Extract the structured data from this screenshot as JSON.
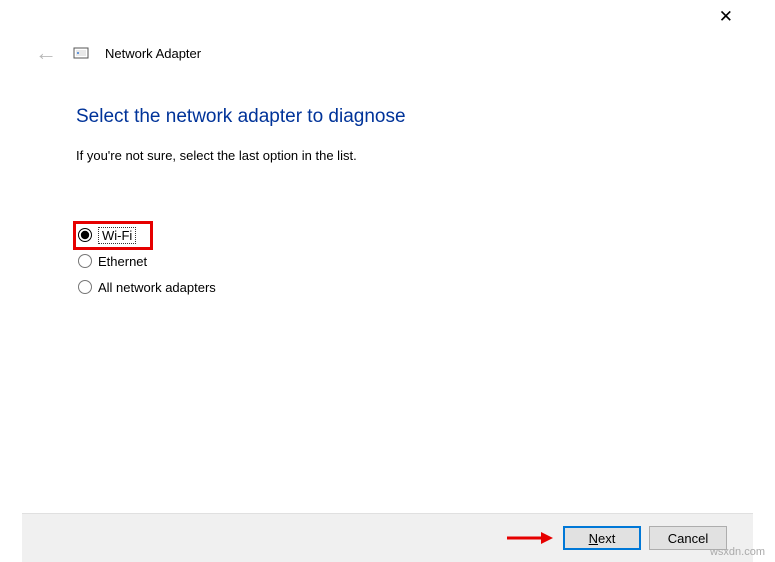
{
  "window": {
    "title": "Network Adapter"
  },
  "content": {
    "heading": "Select the network adapter to diagnose",
    "subtext": "If you're not sure, select the last option in the list."
  },
  "options": {
    "wifi": "Wi-Fi",
    "ethernet": "Ethernet",
    "all": "All network adapters"
  },
  "footer": {
    "next_prefix": "N",
    "next_rest": "ext",
    "cancel": "Cancel"
  },
  "watermark": "wsxdn.com"
}
